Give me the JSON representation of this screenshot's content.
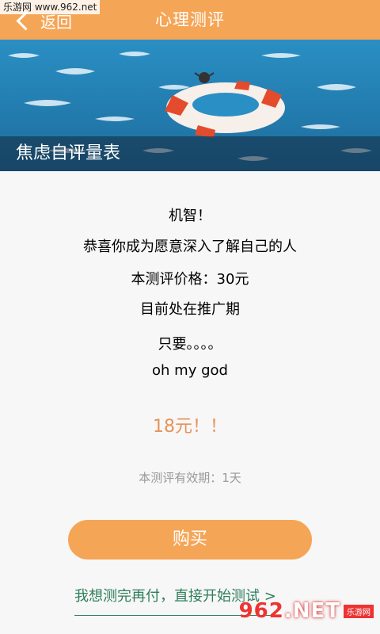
{
  "header": {
    "back_label": "返回",
    "title": "心理测评"
  },
  "watermark_top": "乐游网 www.962.net",
  "banner": {
    "caption": "焦虑自评量表"
  },
  "content": {
    "lines": [
      "机智！",
      "恭喜你成为愿意深入了解自己的人",
      "本测评价格：30元",
      "目前处在推广期",
      "只要。。。。",
      "oh my god"
    ],
    "price": "18元！！",
    "validity": "本测评有效期：1天"
  },
  "actions": {
    "buy_label": "购买",
    "pay_later_label": "我想测完再付，直接开始测试 >"
  },
  "watermark_br": {
    "logo_main": "962",
    "logo_suffix": ".NET",
    "logo_sub": "乐游网"
  },
  "colors": {
    "accent": "#f5a556",
    "price": "#e8925a",
    "link": "#2e7d5b"
  }
}
